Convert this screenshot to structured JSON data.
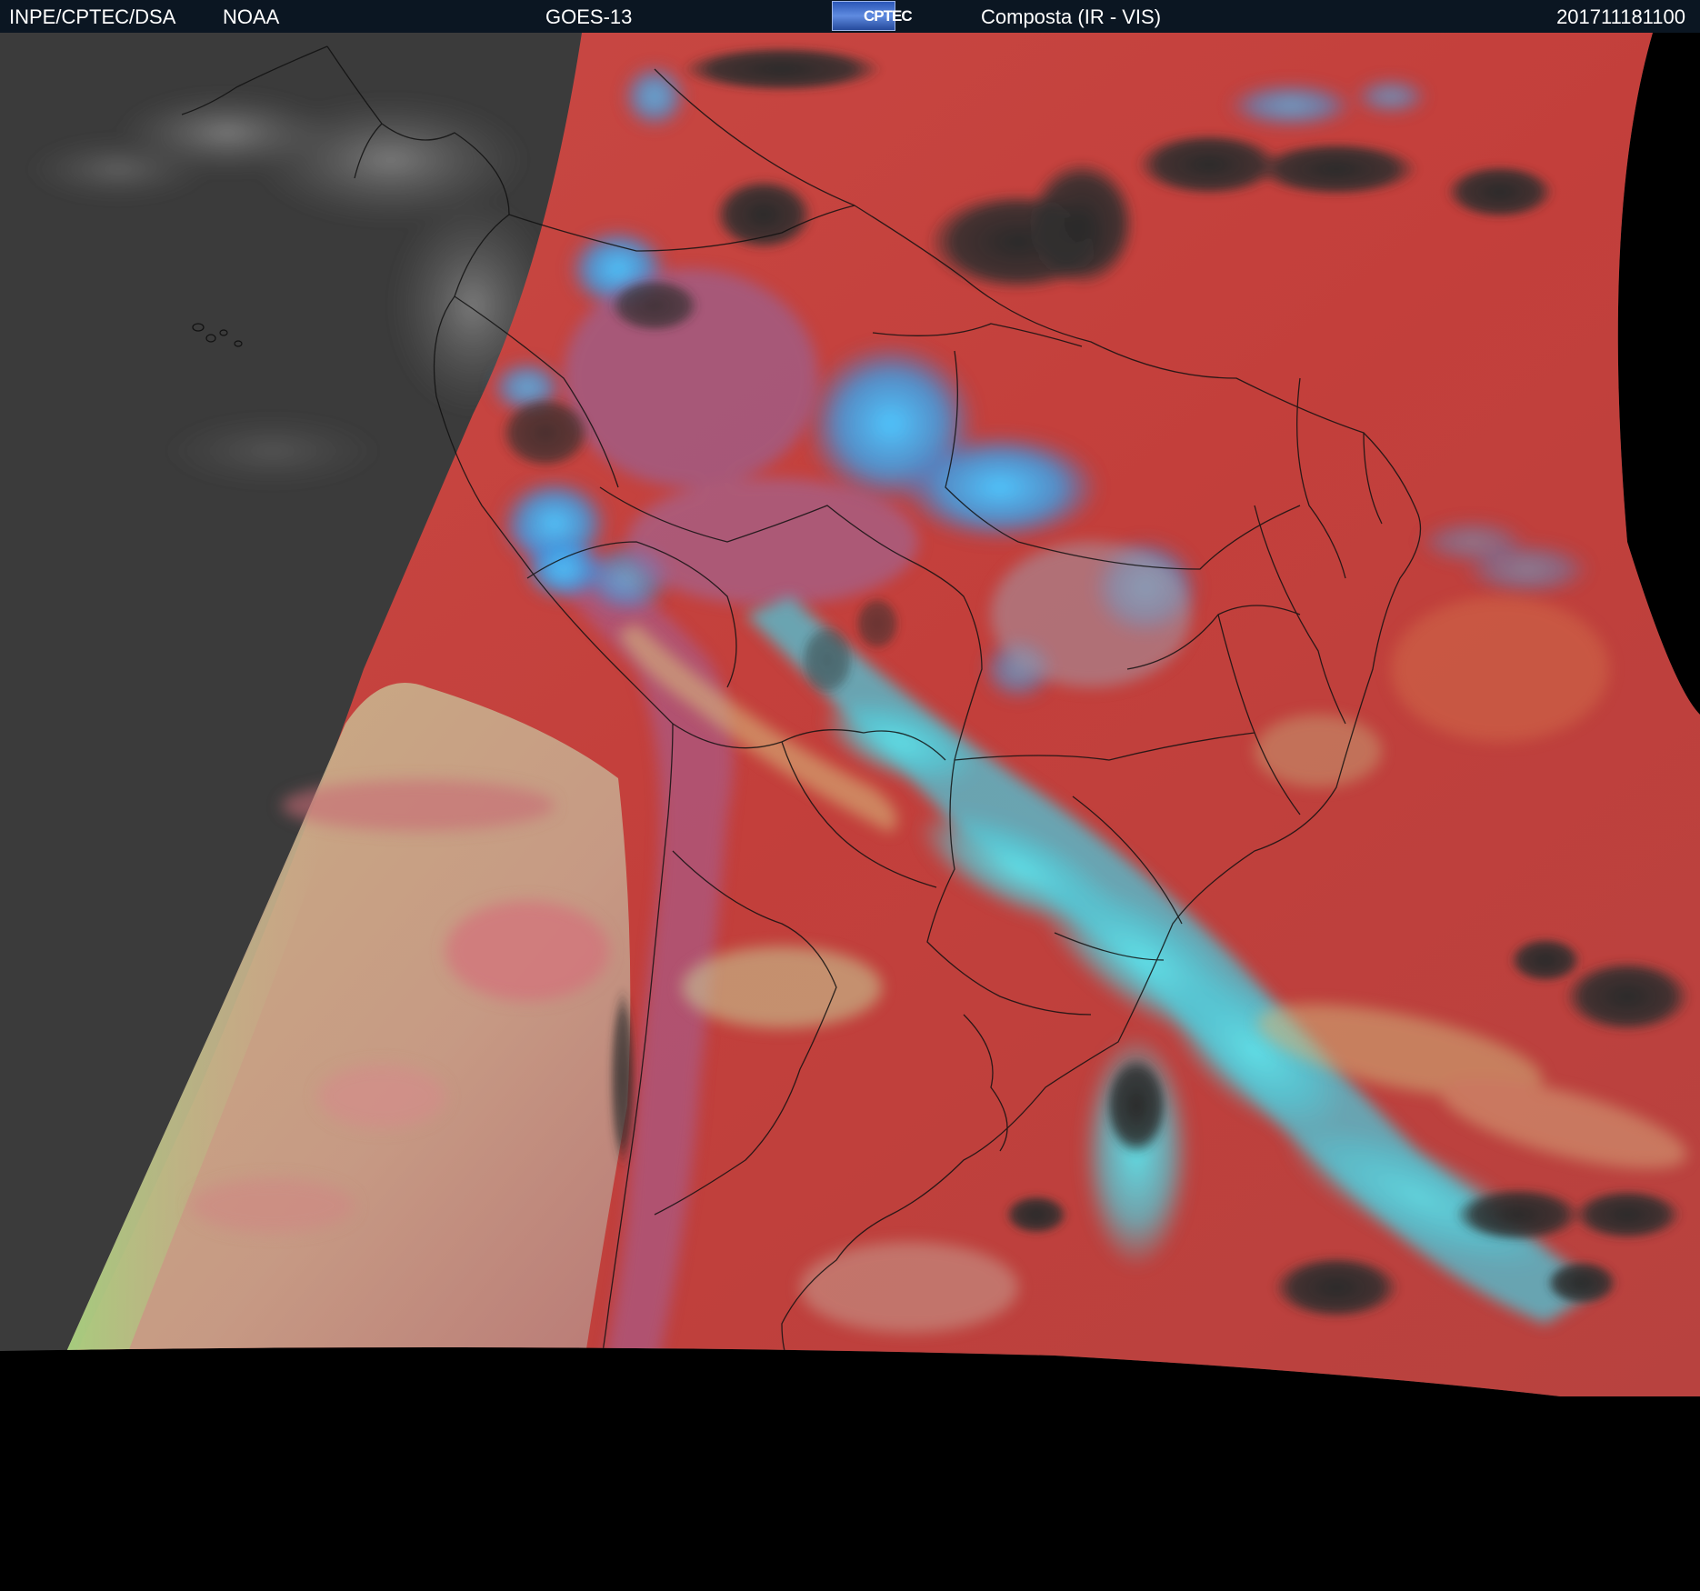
{
  "header": {
    "org": "INPE/CPTEC/DSA",
    "agency": "NOAA",
    "satellite": "GOES-13",
    "logo_text": "CPTEC",
    "product": "Composta (IR - VIS)",
    "timestamp": "201711181100"
  },
  "colors": {
    "header_bg": "#0b1622",
    "space": "#000000",
    "night_side": "#3a3a3a",
    "clear_sky": "#c9403c",
    "high_cold_clouds": "#3fb4f0",
    "low_warm_clouds": "#c8c48a",
    "land_dark": "#2a2a2a",
    "borders": "#111111"
  }
}
